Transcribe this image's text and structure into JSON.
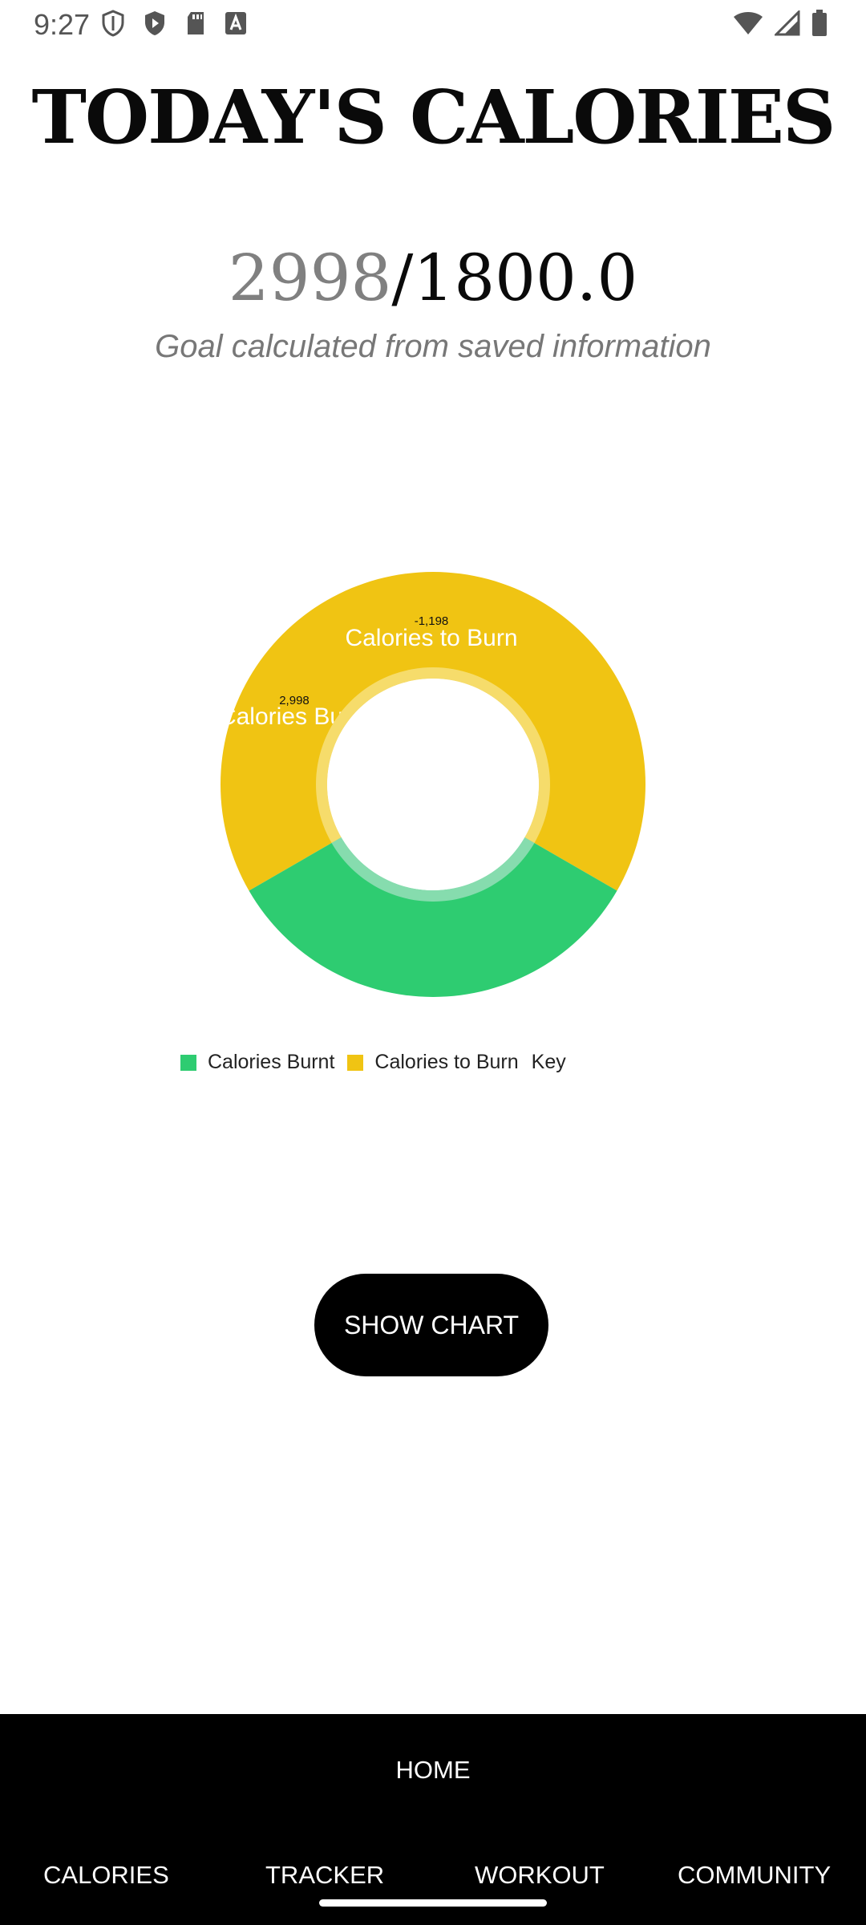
{
  "status_bar": {
    "time": "9:27",
    "left_icons": [
      "shield-icon",
      "play-shield-icon",
      "sd-card-icon",
      "font-a-icon"
    ],
    "right_icons": [
      "wifi-icon",
      "cell-signal-icon",
      "battery-icon"
    ]
  },
  "title": "TODAY'S CALORIES",
  "calories": {
    "consumed": "2998",
    "separator": "/",
    "goal": "1800.0"
  },
  "goal_note": "Goal calculated from saved information",
  "chart_data": {
    "type": "pie",
    "style": "donut",
    "slices": [
      {
        "name": "Calories Burnt",
        "value": 2998,
        "value_label": "2,998",
        "color": "#2ecc71"
      },
      {
        "name": "Calories to Burn",
        "value": -1198,
        "value_label": "-1,198",
        "color": "#f0c413"
      }
    ],
    "legend": {
      "placement": "bottom-left",
      "entries": [
        "Calories Burnt",
        "Calories to Burn"
      ],
      "key_label": "Key"
    }
  },
  "button": {
    "show_chart": "SHOW CHART"
  },
  "nav": {
    "home": "HOME",
    "items": [
      "CALORIES",
      "TRACKER",
      "WORKOUT",
      "COMMUNITY"
    ]
  },
  "colors": {
    "burnt": "#2ecc71",
    "to_burn": "#f0c413",
    "nav_bg": "#000000"
  }
}
